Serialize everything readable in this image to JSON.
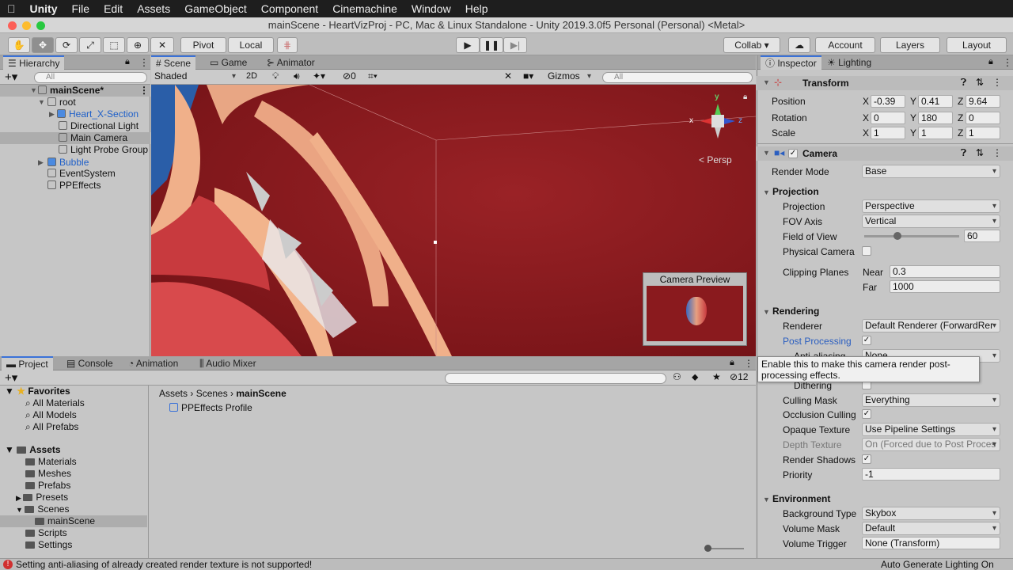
{
  "menubar": {
    "apple": "",
    "items": [
      "Unity",
      "File",
      "Edit",
      "Assets",
      "GameObject",
      "Component",
      "Cinemachine",
      "Window",
      "Help"
    ]
  },
  "window_title": "mainScene - HeartVizProj - PC, Mac & Linux Standalone - Unity 2019.3.0f5 Personal (Personal) <Metal>",
  "toolbar": {
    "pivot": "Pivot",
    "local": "Local",
    "collab": "Collab ▾",
    "account": "Account",
    "layers": "Layers",
    "layout": "Layout"
  },
  "hierarchy": {
    "tab": "Hierarchy",
    "search_placeholder": "All",
    "items": [
      "mainScene*",
      "root",
      "Heart_X-Section",
      "Directional Light",
      "Main Camera",
      "Light Probe Group",
      "Bubble",
      "EventSystem",
      "PPEffects"
    ]
  },
  "scene": {
    "tabs": [
      "Scene",
      "Game",
      "Animator"
    ],
    "shading": "Shaded",
    "mode_2d": "2D",
    "hidden_count": "0",
    "gizmos": "Gizmos",
    "search_placeholder": "All",
    "persp": "< Persp",
    "camera_preview": "Camera Preview",
    "gizmo_axes": [
      "y",
      "x",
      "z"
    ]
  },
  "inspector": {
    "tabs": [
      "Inspector",
      "Lighting"
    ],
    "transform": {
      "title": "Transform",
      "position": {
        "label": "Position",
        "x": "-0.39",
        "y": "0.41",
        "z": "9.64"
      },
      "rotation": {
        "label": "Rotation",
        "x": "0",
        "y": "180",
        "z": "0"
      },
      "scale": {
        "label": "Scale",
        "x": "1",
        "y": "1",
        "z": "1"
      }
    },
    "camera": {
      "title": "Camera",
      "render_mode_label": "Render Mode",
      "render_mode": "Base",
      "projection_section": "Projection",
      "projection_label": "Projection",
      "projection": "Perspective",
      "fov_axis_label": "FOV Axis",
      "fov_axis": "Vertical",
      "fov_label": "Field of View",
      "fov": "60",
      "fov_slider_fraction": 0.35,
      "physical_label": "Physical Camera",
      "clipping_label": "Clipping Planes",
      "near_label": "Near",
      "near": "0.3",
      "far_label": "Far",
      "far": "1000",
      "rendering_section": "Rendering",
      "renderer_label": "Renderer",
      "renderer": "Default Renderer (ForwardRer",
      "post_label": "Post Processing",
      "aa_label": "Anti-aliasing",
      "aa": "None",
      "dithering_label": "Dithering",
      "culling_label": "Culling Mask",
      "culling": "Everything",
      "occlusion_label": "Occlusion Culling",
      "opaque_label": "Opaque Texture",
      "opaque": "Use Pipeline Settings",
      "depth_label": "Depth Texture",
      "depth": "On (Forced due to Post Proces",
      "shadows_label": "Render Shadows",
      "priority_label": "Priority",
      "priority": "-1",
      "environment_section": "Environment",
      "bg_label": "Background Type",
      "bg": "Skybox",
      "volmask_label": "Volume Mask",
      "volmask": "Default",
      "voltrigger_label": "Volume Trigger",
      "voltrigger": "None (Transform)"
    },
    "tooltip": "Enable this to make this camera render post-processing effects."
  },
  "project": {
    "tabs": [
      "Project",
      "Console",
      "Animation",
      "Audio Mixer"
    ],
    "hidden_count": "12",
    "favorites": "Favorites",
    "fav_items": [
      "All Materials",
      "All Models",
      "All Prefabs"
    ],
    "assets": "Assets",
    "folders": [
      "Materials",
      "Meshes",
      "Prefabs",
      "Presets",
      "Scenes",
      "mainScene",
      "Scripts",
      "Settings"
    ],
    "breadcrumb": [
      "Assets",
      "Scenes",
      "mainScene"
    ],
    "files": [
      "PPEffects Profile"
    ]
  },
  "status": {
    "error": "Setting anti-aliasing of already created render texture is not supported!",
    "lighting": "Auto Generate Lighting On"
  },
  "colors": {
    "accent": "#3a72d8",
    "scene_bg": "#8e1c20",
    "error": "#d03030"
  }
}
